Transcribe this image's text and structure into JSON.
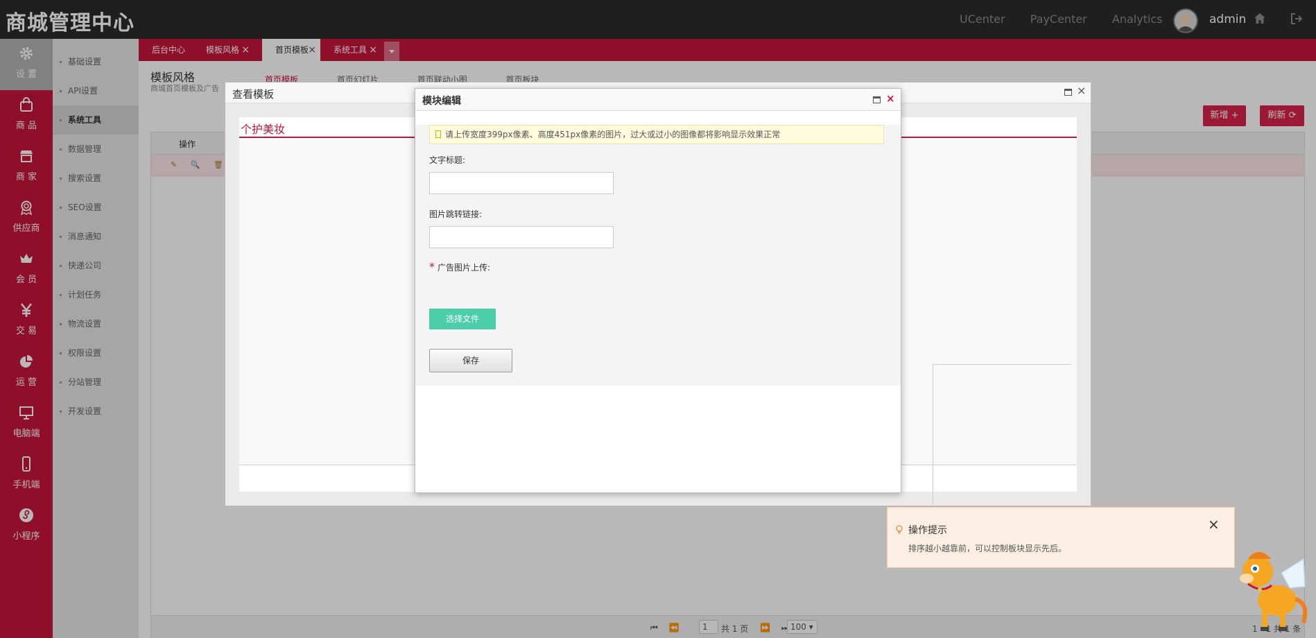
{
  "app": {
    "logo": "商城管理中心",
    "top_links": [
      "UCenter",
      "PayCenter",
      "Analytics"
    ],
    "user": "admin"
  },
  "leftnav": [
    {
      "label": "设 置",
      "icon": "gear-icon",
      "active": true
    },
    {
      "label": "商 品",
      "icon": "bag-icon"
    },
    {
      "label": "商 家",
      "icon": "store-icon"
    },
    {
      "label": "供应商",
      "icon": "badge-icon"
    },
    {
      "label": "会 员",
      "icon": "crown-icon"
    },
    {
      "label": "交 易",
      "icon": "yen-icon"
    },
    {
      "label": "运 营",
      "icon": "pie-icon"
    },
    {
      "label": "电脑端",
      "icon": "monitor-icon"
    },
    {
      "label": "手机端",
      "icon": "phone-icon"
    },
    {
      "label": "小程序",
      "icon": "miniprogram-icon"
    }
  ],
  "subnav": [
    "基础设置",
    "API设置",
    "系统工具",
    "数据管理",
    "搜索设置",
    "SEO设置",
    "消息通知",
    "快递公司",
    "计划任务",
    "物流设置",
    "权限设置",
    "分站管理",
    "开发设置"
  ],
  "tabs": [
    {
      "label": "后台中心",
      "closable": false
    },
    {
      "label": "模板风格",
      "closable": true
    },
    {
      "label": "首页模板",
      "closable": true,
      "active": true
    },
    {
      "label": "系统工具",
      "closable": true
    }
  ],
  "page": {
    "title": "模板风格",
    "subtitle": "商城首页模板及广告",
    "subtabs": [
      "首页模板",
      "首页幻灯片",
      "首页联动小图",
      "首页板块"
    ],
    "add_label": "新增 +",
    "refresh_label": "刷新 ⟳",
    "table_op_header": "操作",
    "row_icons": "✎ 🔍 🗑",
    "pager": {
      "page_value": "1",
      "page_info": "共 1 页",
      "page_size": "100 ▾",
      "range": "1 - 1 共 1 条"
    }
  },
  "modal_outer": {
    "title": "查看模板",
    "section": "个护美妆"
  },
  "modal_inner": {
    "title": "模块编辑",
    "notice": "请上传宽度399px像素、高度451px像素的图片，过大或过小的图像都将影响显示效果正常",
    "text_title_label": "文字标题:",
    "text_title_value": "",
    "link_label": "图片跳转链接:",
    "link_value": "",
    "upload_label": "广告图片上传:",
    "required_mark": "*",
    "file_button": "选择文件",
    "save_button": "保存"
  },
  "tip": {
    "title": "操作提示",
    "body": "排序越小越靠前，可以控制板块显示先后。"
  },
  "colors": {
    "brand_red": "#c6153b",
    "topbar": "#2b2b2b",
    "file_button": "#4ccfa9"
  }
}
